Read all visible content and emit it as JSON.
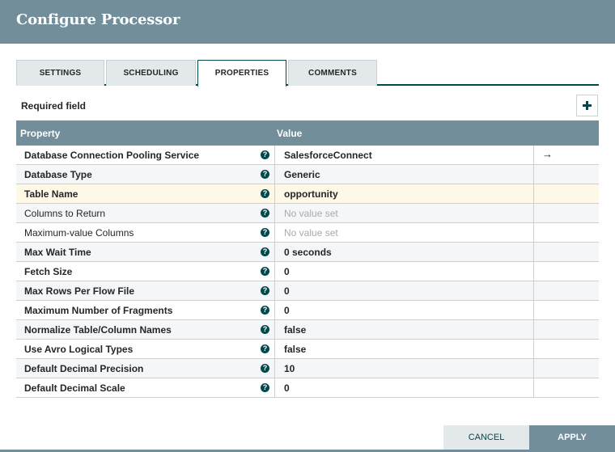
{
  "dialog": {
    "title": "Configure Processor"
  },
  "tabs": [
    {
      "label": "SETTINGS",
      "selected": false
    },
    {
      "label": "SCHEDULING",
      "selected": false
    },
    {
      "label": "PROPERTIES",
      "selected": true
    },
    {
      "label": "COMMENTS",
      "selected": false
    }
  ],
  "properties_panel": {
    "required_label": "Required field",
    "add_button_icon": "plus-icon",
    "columns": {
      "property": "Property",
      "value": "Value"
    },
    "rows": [
      {
        "name": "Database Connection Pooling Service",
        "value": "SalesforceConnect",
        "required": true,
        "has_value": true,
        "goto": "→"
      },
      {
        "name": "Database Type",
        "value": "Generic",
        "required": true,
        "has_value": true
      },
      {
        "name": "Table Name",
        "value": "opportunity",
        "required": true,
        "has_value": true,
        "highlighted": true
      },
      {
        "name": "Columns to Return",
        "value": "No value set",
        "required": false,
        "has_value": false
      },
      {
        "name": "Maximum-value Columns",
        "value": "No value set",
        "required": false,
        "has_value": false
      },
      {
        "name": "Max Wait Time",
        "value": "0 seconds",
        "required": true,
        "has_value": true
      },
      {
        "name": "Fetch Size",
        "value": "0",
        "required": true,
        "has_value": true
      },
      {
        "name": "Max Rows Per Flow File",
        "value": "0",
        "required": true,
        "has_value": true
      },
      {
        "name": "Maximum Number of Fragments",
        "value": "0",
        "required": true,
        "has_value": true
      },
      {
        "name": "Normalize Table/Column Names",
        "value": "false",
        "required": true,
        "has_value": true
      },
      {
        "name": "Use Avro Logical Types",
        "value": "false",
        "required": true,
        "has_value": true
      },
      {
        "name": "Default Decimal Precision",
        "value": "10",
        "required": true,
        "has_value": true
      },
      {
        "name": "Default Decimal Scale",
        "value": "0",
        "required": true,
        "has_value": true
      }
    ],
    "help_icon_glyph": "?"
  },
  "footer": {
    "cancel_label": "CANCEL",
    "apply_label": "APPLY"
  },
  "colors": {
    "header_bg": "#728e9b",
    "accent": "#004849",
    "tab_bg": "#e3e8eb",
    "highlight_row": "#fdf9e6"
  }
}
